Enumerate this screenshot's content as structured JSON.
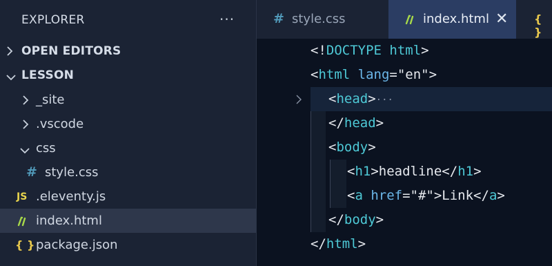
{
  "sidebar": {
    "title": "EXPLORER",
    "more_icon": "more-actions-icon",
    "more_glyph": "···",
    "sections": {
      "open_editors": "OPEN EDITORS",
      "lesson": "LESSON"
    },
    "tree": {
      "site": "_site",
      "vscode": ".vscode",
      "css": "css",
      "style_css": "style.css",
      "eleventy": ".eleventy.js",
      "index_html": "index.html",
      "package_json": "package.json"
    },
    "icons": {
      "hash_glyph": "#",
      "js_glyph": "JS",
      "json_glyph": "{ }"
    }
  },
  "tabs": {
    "style_css": "style.css",
    "index_html": "index.html",
    "close_glyph": "✕",
    "json_glyph": "{ }"
  },
  "editor": {
    "fold_ellipsis": "···",
    "lines": {
      "l1_a": "<!",
      "l1_b": "DOCTYPE html",
      "l1_c": ">",
      "l2_a": "<",
      "l2_b": "html",
      "l2_c": " lang",
      "l2_d": "=\"en\">",
      "l3_a": "<",
      "l3_b": "head",
      "l3_c": ">",
      "l4_a": "</",
      "l4_b": "head",
      "l4_c": ">",
      "l5_a": "<",
      "l5_b": "body",
      "l5_c": ">",
      "l6_a": "<",
      "l6_b": "h1",
      "l6_c": ">headline</",
      "l6_d": "h1",
      "l6_e": ">",
      "l7_a": "<",
      "l7_b": "a",
      "l7_c": " href",
      "l7_d": "=\"#\">Link</",
      "l7_e": "a",
      "l7_f": ">",
      "l8_a": "</",
      "l8_b": "body",
      "l8_c": ">",
      "l9_a": "</",
      "l9_b": "html",
      "l9_c": ">"
    }
  },
  "colors": {
    "sidebar_bg": "#1b2334",
    "editor_bg": "#0b1220",
    "active_tab_bg": "#2b3d63",
    "tag_color": "#4ec9d6",
    "attr_color": "#6bb6e8",
    "css_icon_color": "#519aba",
    "js_icon_color": "#e8d44d",
    "eleventy_icon_color": "#a7d94a"
  }
}
